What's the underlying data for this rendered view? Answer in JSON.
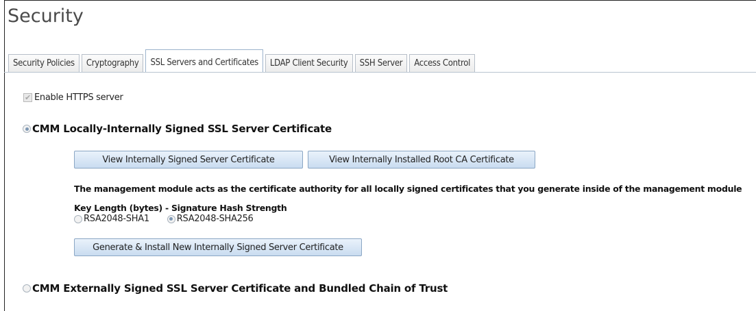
{
  "page": {
    "title": "Security"
  },
  "tabs": [
    {
      "label": "Security Policies",
      "active": false
    },
    {
      "label": "Cryptography",
      "active": false
    },
    {
      "label": "SSL Servers and Certificates",
      "active": true
    },
    {
      "label": "LDAP Client Security",
      "active": false
    },
    {
      "label": "SSH Server",
      "active": false
    },
    {
      "label": "Access Control",
      "active": false
    }
  ],
  "https": {
    "label": "Enable HTTPS server",
    "checked": true,
    "disabled": true
  },
  "internal_cert": {
    "heading": "CMM Locally-Internally Signed SSL Server Certificate",
    "selected": true,
    "view_server_button": "View Internally Signed Server Certificate",
    "view_root_button": "View Internally Installed Root CA Certificate",
    "description": "The management module acts as the certificate authority for all locally signed certificates that you generate inside of the management module",
    "key_length_label": "Key Length (bytes) - Signature Hash Strength",
    "key_options": [
      {
        "label": "RSA2048-SHA1",
        "selected": false
      },
      {
        "label": "RSA2048-SHA256",
        "selected": true
      }
    ],
    "generate_button": "Generate & Install New Internally Signed Server Certificate"
  },
  "external_cert": {
    "heading": "CMM Externally Signed SSL Server Certificate and Bundled Chain of Trust",
    "selected": false
  },
  "colors": {
    "button_top": "#eaf2fb",
    "button_bottom": "#c9dcf0",
    "button_border": "#8aa6c4",
    "radio_dot": "#7e98b4",
    "title_text": "#4a4a4a"
  }
}
